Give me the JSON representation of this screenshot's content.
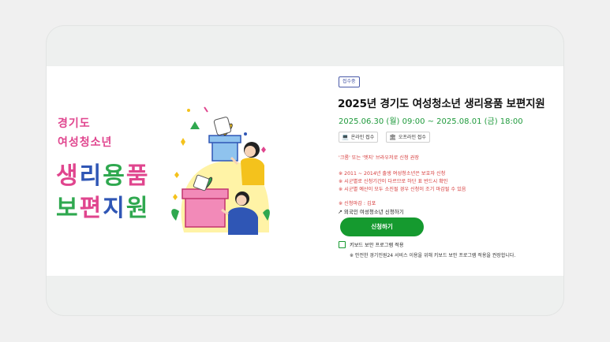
{
  "left": {
    "title_line1": "경기도",
    "title_line2": "여성청소년",
    "title_big1": [
      "생",
      "리",
      "용",
      "품"
    ],
    "title_big2": [
      "보",
      "편",
      "지",
      "원"
    ],
    "colors": {
      "pink": "#e0458e",
      "green": "#2fa84f",
      "blue": "#2f56b5",
      "red": "#e53a3a",
      "yellow": "#f4c21c",
      "illustration_bg": "#fff3a6"
    }
  },
  "right": {
    "badge": "접수중",
    "title": "2025년 경기도 여성청소년 생리용품 보편지원",
    "period": "2025.06.30 (월) 09:00 ~ 2025.08.01 (금) 18:00",
    "chips": [
      {
        "icon": "laptop-icon",
        "glyph": "💻",
        "label": "온라인 접수"
      },
      {
        "icon": "bank-icon",
        "glyph": "🏛",
        "label": "오프라인 접수"
      }
    ],
    "notes": [
      "'크롬' 또는 '엣지' 브라우저로 신청 권장",
      "※ 2011 ~ 2014년 출생 여성청소년은 보호자 신청",
      "※ 시군별로 신청기간이 다르므로 하단 표 반드시 확인",
      "※ 시군별 예산이 모두 소진될 경우 신청이 조기 마감될 수 있음",
      "※ 신청마감 : 김포"
    ],
    "link_label": "외국인 여성청소년 신청하기",
    "apply_label": "신청하기",
    "checkbox_label": "키보드 보안 프로그램 적용",
    "checkbox_note": "※ 안전한 경기민원24 서비스 이용을 위해 키보드 보안 프로그램 적용을 권장합니다.",
    "colors": {
      "accent": "#159a2f",
      "note": "#d63a3a",
      "badge": "#4a5aa8"
    }
  }
}
